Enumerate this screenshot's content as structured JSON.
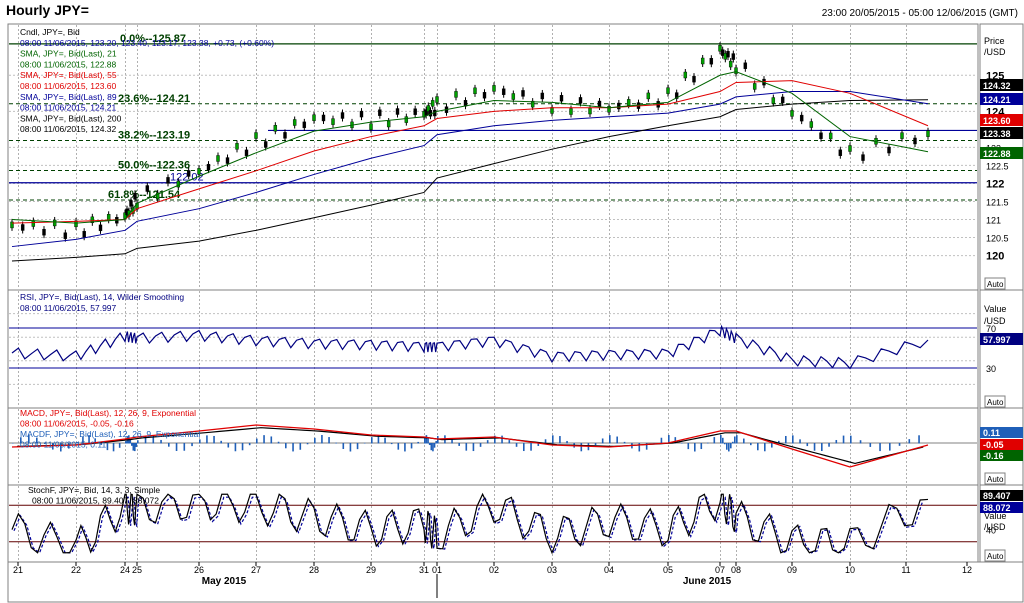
{
  "window": {
    "title": "Hourly JPY=",
    "time_range": "23:00 20/05/2015 - 05:00 12/06/2015 (GMT)"
  },
  "colors": {
    "price_axis_bg": "#ffffff",
    "sma21": "#006400",
    "sma55": "#e00000",
    "sma89": "#000099",
    "sma200": "#000000",
    "rsi": "#000080",
    "macd": "#e00000",
    "macd_signal": "#000000",
    "macdf_hist": "#1f5fb8",
    "stoch_k": "#000000",
    "stoch_d": "#000099"
  },
  "price_panel": {
    "legend": [
      "Cndl, JPY=, Bid",
      "08:00 11/06/2015, 123.20, 123.40, 123.17, 123.38, +0.73, (+0.60%)",
      "SMA, JPY=, Bid(Last), 21",
      "08:00 11/06/2015, 122.88",
      "SMA, JPY=, Bid(Last), 55",
      "08:00 11/06/2015, 123.60",
      "SMA, JPY=, Bid(Last), 89",
      "08:00 11/06/2015, 124.21",
      "SMA, JPY=, Bid(Last), 200",
      "08:00 11/06/2015, 124.32"
    ],
    "axis_title": [
      "Price",
      "/USD"
    ],
    "axis_ticks": [
      "125",
      "124",
      "123",
      "122.5",
      "122",
      "121.5",
      "121",
      "120.5",
      "120"
    ],
    "auto": "Auto",
    "fib_levels": [
      {
        "label": "0.0%--125.87",
        "value": 125.87
      },
      {
        "label": "23.6%--124.21",
        "value": 124.21
      },
      {
        "label": "38.2%--123.19",
        "value": 123.19
      },
      {
        "label": "50.0%--122.36",
        "value": 122.36
      },
      {
        "label": "61.8%--121.54",
        "value": 121.54
      }
    ],
    "horizontal_lines": [
      {
        "label": "",
        "value": 123.47
      },
      {
        "label": "122.02",
        "value": 122.02
      }
    ],
    "tags": [
      {
        "text": "124.32",
        "value": 124.32,
        "color": "#000000"
      },
      {
        "text": "124.21",
        "value": 124.21,
        "color": "#000099"
      },
      {
        "text": "123.60",
        "value": 123.6,
        "color": "#e00000"
      },
      {
        "text": "123.38",
        "value": 123.38,
        "color": "#000000"
      },
      {
        "text": "122.88",
        "value": 122.88,
        "color": "#006400"
      }
    ]
  },
  "rsi_panel": {
    "legend": [
      "RSI, JPY=, Bid(Last), 14, Wilder Smoothing",
      "08:00 11/06/2015, 57.997"
    ],
    "axis_title": [
      "Value",
      "/USD"
    ],
    "axis_ticks": [
      "70",
      "30"
    ],
    "value_tag": "57.997",
    "auto": "Auto"
  },
  "macd_panel": {
    "legend": [
      "MACD, JPY=, Bid(Last), 12, 26, 9, Exponential",
      "08:00 11/06/2015, -0.05, -0.16",
      "MACDF, JPY=, Bid(Last), 12, 26, 9, Exponential",
      "08:00 11/06/2015, 0.11"
    ],
    "tags": [
      {
        "text": "0.11",
        "color": "#1f5fb8"
      },
      {
        "text": "-0.05",
        "color": "#e00000"
      },
      {
        "text": "-0.16",
        "color": "#006400"
      }
    ],
    "auto": "Auto"
  },
  "stoch_panel": {
    "legend": [
      "StochF, JPY=, Bid, 14, 3, 3, Simple",
      "08:00 11/06/2015, 89.407, 88.072"
    ],
    "axis_title": [
      "Value",
      "/USD"
    ],
    "axis_ticks": [
      "40"
    ],
    "tags": [
      {
        "text": "89.407",
        "color": "#000000"
      },
      {
        "text": "88.072",
        "color": "#000099"
      }
    ],
    "auto": "Auto"
  },
  "time_axis": {
    "day_labels": [
      "21",
      "22",
      "24",
      "25",
      "26",
      "27",
      "28",
      "29",
      "31",
      "01",
      "02",
      "03",
      "04",
      "05",
      "07",
      "08",
      "09",
      "10",
      "11",
      "12"
    ],
    "month_labels": [
      "May 2015",
      "June 2015"
    ]
  },
  "chart_data": {
    "type": "line",
    "title": "Hourly JPY=",
    "x_label": "",
    "y_label": "Price /USD",
    "ylim": [
      119.6,
      126.2
    ],
    "x": [
      "21",
      "22",
      "24",
      "25",
      "26",
      "27",
      "28",
      "29",
      "31",
      "01",
      "02",
      "03",
      "04",
      "05",
      "07",
      "08",
      "09",
      "10",
      "11"
    ],
    "series": [
      {
        "name": "Cndl, JPY=, Bid",
        "values": [
          120.85,
          120.7,
          121.1,
          121.55,
          122.35,
          123.15,
          123.8,
          123.75,
          123.95,
          124.15,
          124.6,
          124.2,
          124.1,
          124.4,
          125.7,
          125.3,
          124.0,
          122.8,
          123.38
        ]
      },
      {
        "name": "SMA, JPY=, Bid(Last), 21",
        "values": [
          121.0,
          120.9,
          121.0,
          121.45,
          122.2,
          122.85,
          123.45,
          123.7,
          123.85,
          124.0,
          124.3,
          124.25,
          124.1,
          124.25,
          125.0,
          125.1,
          124.5,
          123.3,
          122.88
        ]
      },
      {
        "name": "SMA, JPY=, Bid(Last), 55",
        "values": [
          120.9,
          120.95,
          121.0,
          121.3,
          121.85,
          122.35,
          122.9,
          123.3,
          123.6,
          123.8,
          124.0,
          124.1,
          124.1,
          124.2,
          124.55,
          124.8,
          124.85,
          124.5,
          123.6
        ]
      },
      {
        "name": "SMA, JPY=, Bid(Last), 89",
        "values": [
          120.25,
          120.45,
          120.7,
          120.95,
          121.3,
          121.75,
          122.25,
          122.7,
          123.05,
          123.35,
          123.6,
          123.75,
          123.85,
          123.95,
          124.2,
          124.4,
          124.55,
          124.55,
          124.21
        ]
      },
      {
        "name": "SMA, JPY=, Bid(Last), 200",
        "values": [
          119.85,
          119.95,
          120.05,
          120.2,
          120.4,
          120.7,
          121.05,
          121.4,
          121.75,
          122.15,
          122.55,
          122.95,
          123.3,
          123.6,
          123.85,
          124.05,
          124.2,
          124.3,
          124.32
        ]
      },
      {
        "name": "RSI, JPY=, Bid(Last), 14, Wilder Smoothing",
        "values": [
          45,
          42,
          62,
          60,
          63,
          58,
          55,
          54,
          52,
          52,
          58,
          42,
          44,
          45,
          68,
          60,
          38,
          35,
          57.997
        ]
      },
      {
        "name": "MACD, JPY=, Bid(Last), 12, 26, 9, Exponential",
        "values": [
          -0.1,
          -0.05,
          0.1,
          0.15,
          0.3,
          0.45,
          0.35,
          0.2,
          0.15,
          0.1,
          0.15,
          -0.05,
          -0.1,
          0.0,
          0.3,
          0.3,
          -0.15,
          -0.6,
          -0.05
        ]
      },
      {
        "name": "StochF, JPY=, Bid, 14, 3, 3, Simple",
        "values": [
          40,
          10,
          80,
          75,
          85,
          80,
          60,
          40,
          50,
          30,
          80,
          30,
          55,
          40,
          90,
          60,
          20,
          15,
          89.407
        ]
      }
    ]
  }
}
